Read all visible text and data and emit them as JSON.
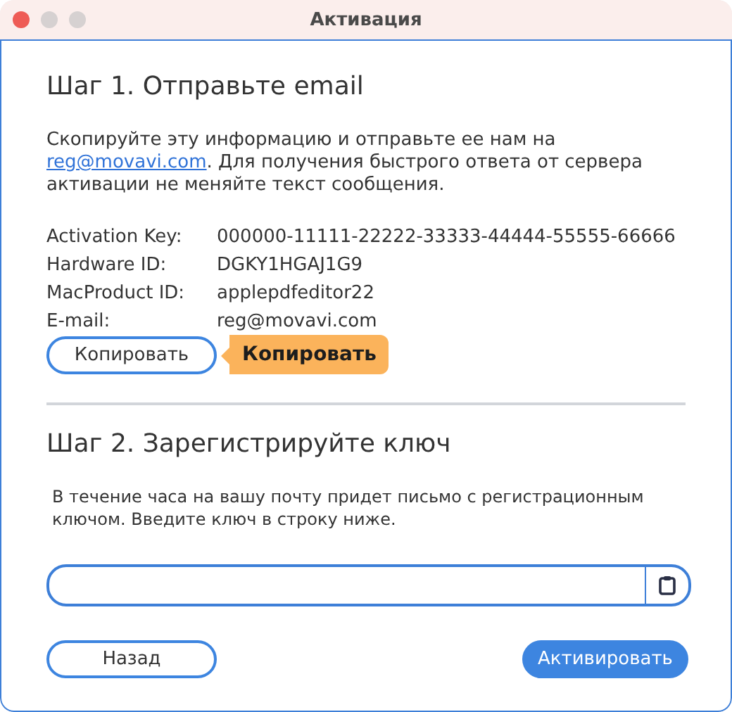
{
  "window": {
    "title": "Активация"
  },
  "step1": {
    "heading": "Шаг 1. Отправьте email",
    "text_before": "Скопируйте эту информацию и отправьте ее нам на ",
    "link": "reg@movavi.com",
    "text_after": ". Для получения быстрого ответа от сервера активации не меняйте текст сообщения.",
    "info": [
      {
        "label": "Activation Key:",
        "value": "000000-11111-22222-33333-44444-55555-66666"
      },
      {
        "label": "Hardware ID:",
        "value": "DGKY1HGAJ1G9"
      },
      {
        "label": "MacProduct ID:",
        "value": "applepdfeditor22"
      },
      {
        "label": "E-mail:",
        "value": "reg@movavi.com"
      }
    ],
    "copy_button": "Копировать",
    "tooltip": "Копировать"
  },
  "step2": {
    "heading": "Шаг 2. Зарегистрируйте ключ",
    "text": "В течение часа на вашу почту придет письмо с регистрационным ключом. Введите ключ в строку ниже."
  },
  "buttons": [
    {
      "label": "Назад",
      "kind": "secondary"
    },
    {
      "label": "Активировать",
      "kind": "primary"
    }
  ]
}
